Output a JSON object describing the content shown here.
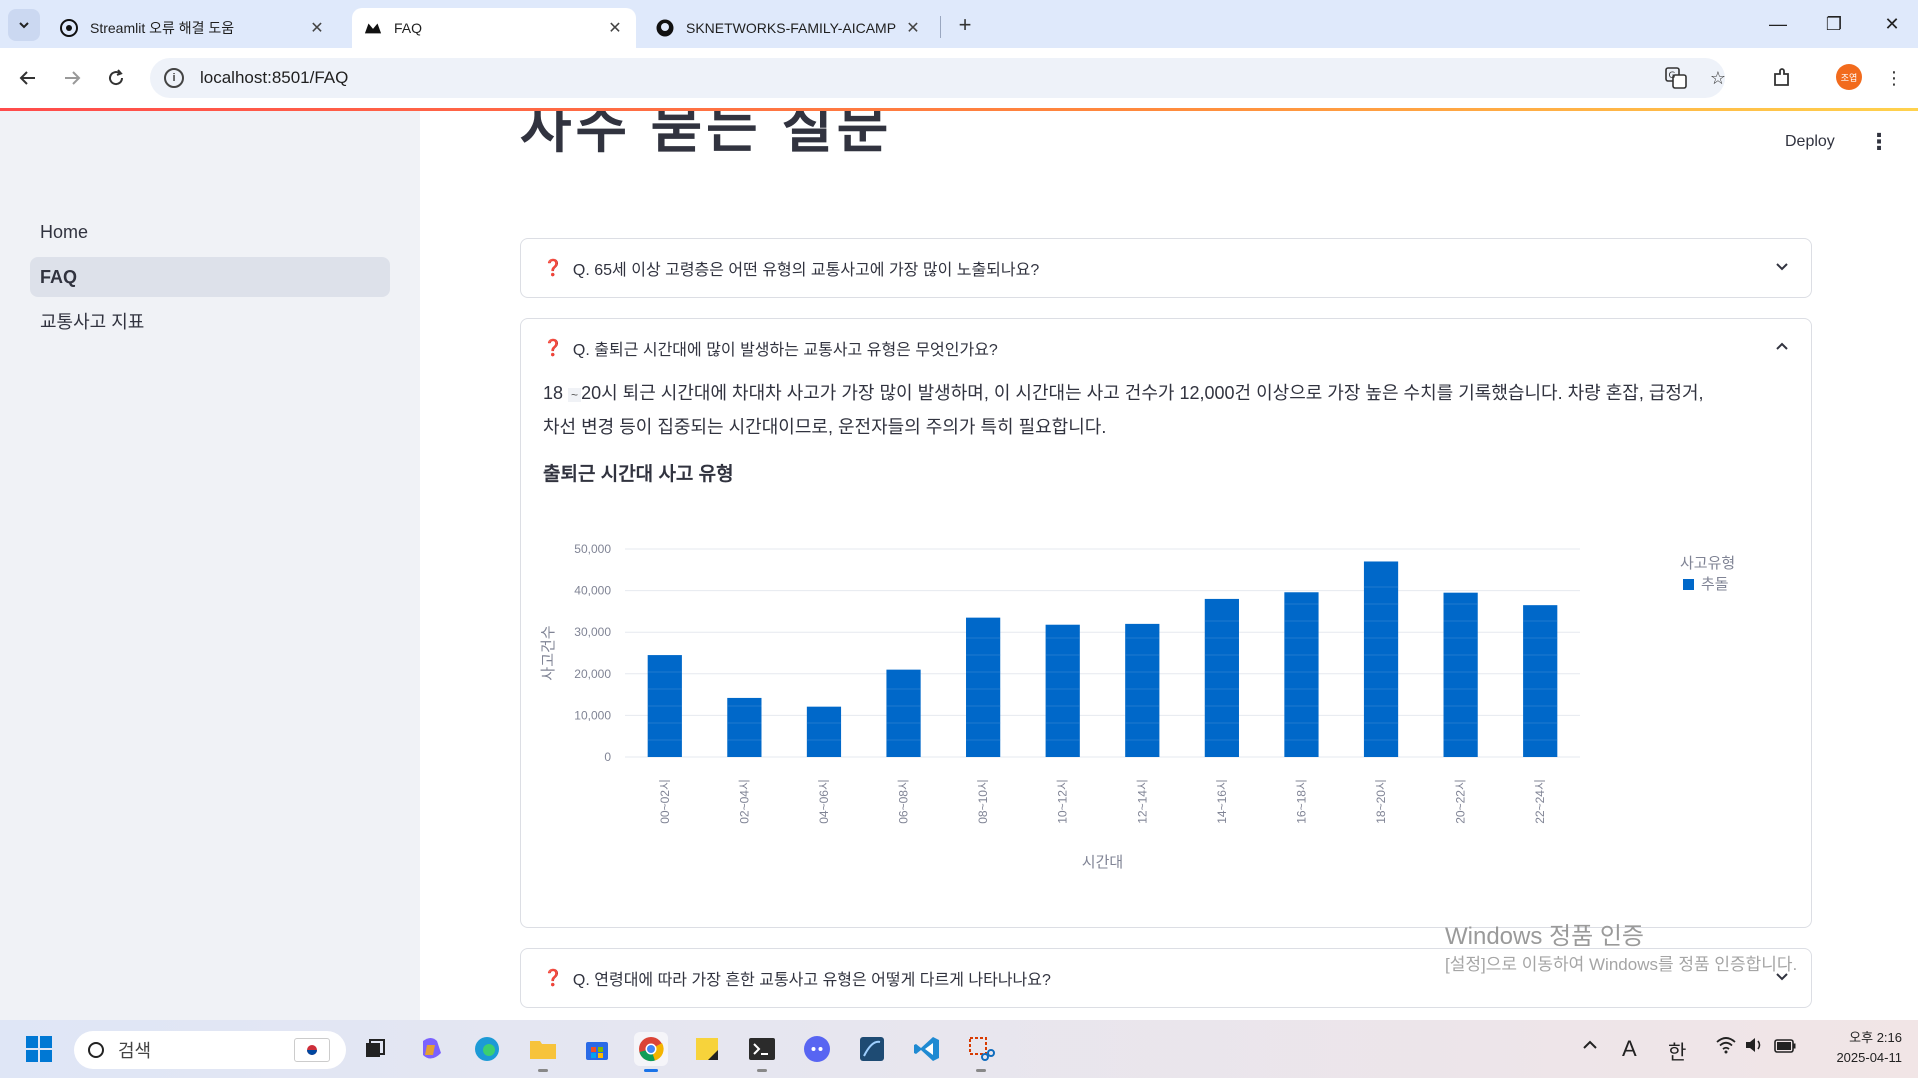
{
  "browser": {
    "tabs": [
      {
        "title": "Streamlit 오류 해결 도움",
        "active": false
      },
      {
        "title": "FAQ",
        "active": true
      },
      {
        "title": "SKNETWORKS-FAMILY-AICAMP",
        "active": false
      }
    ],
    "url": "localhost:8501/FAQ",
    "profile_initials": "조엽"
  },
  "sidebar": {
    "items": [
      {
        "label": "Home",
        "active": false
      },
      {
        "label": "FAQ",
        "active": true
      },
      {
        "label": "교통사고 지표",
        "active": false
      }
    ]
  },
  "header": {
    "deploy_label": "Deploy",
    "page_title": "자주 묻는 질문"
  },
  "faq": {
    "q1": "Q. 65세 이상 고령층은 어떤 유형의 교통사고에 가장 많이 노출되나요?",
    "q2": "Q. 출퇴근 시간대에 많이 발생하는 교통사고 유형은 무엇인가요?",
    "q2_answer_prefix": "18",
    "q2_answer_tilde": "~",
    "q2_answer_line1": "20시 퇴근 시간대에 차대차 사고가 가장 많이 발생하며, 이 시간대는 사고 건수가 12,000건 이상으로 가장 높은 수치를 기록했습니다. 차량 혼잡, 급정거,",
    "q2_answer_line2": "차선 변경 등이 집중되는 시간대이므로, 운전자들의 주의가 특히 필요합니다.",
    "chart_heading": "출퇴근 시간대 사고 유형",
    "q3": "Q. 연령대에 따라 가장 흔한 교통사고 유형은 어떻게 다르게 나타나나요?"
  },
  "chart_data": {
    "type": "bar",
    "title": "",
    "xlabel": "시간대",
    "ylabel": "사고건수",
    "categories": [
      "00~02시",
      "02~04시",
      "04~06시",
      "06~08시",
      "08~10시",
      "10~12시",
      "12~14시",
      "14~16시",
      "16~18시",
      "18~20시",
      "20~22시",
      "22~24시"
    ],
    "series": [
      {
        "name": "추돌",
        "values": [
          24500,
          14200,
          12100,
          21000,
          33500,
          31800,
          32000,
          38000,
          39600,
          47000,
          39500,
          36500
        ]
      }
    ],
    "ylim": [
      0,
      50000
    ],
    "yticks": [
      "0",
      "10,000",
      "20,000",
      "30,000",
      "40,000",
      "50,000"
    ],
    "legend_title": "사고유형",
    "legend_position": "top-right",
    "bar_color": "#0068c9",
    "grid": true
  },
  "watermark": {
    "line1": "Windows 정품 인증",
    "line2": "[설정]으로 이동하여 Windows를 정품 인증합니다."
  },
  "taskbar": {
    "search_placeholder": "검색",
    "ime_a": "A",
    "ime_han": "한",
    "time": "오후 2:16",
    "date": "2025-04-11"
  }
}
